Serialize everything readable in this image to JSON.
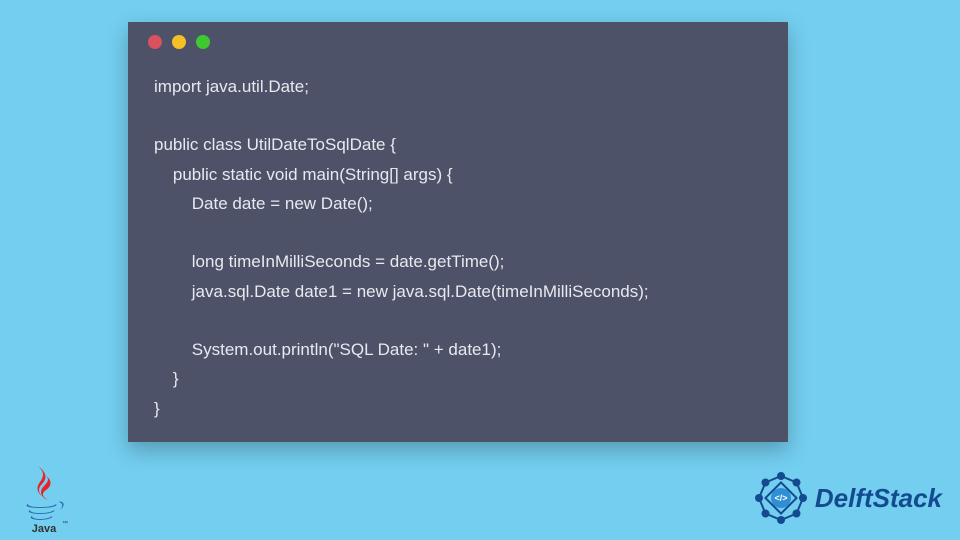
{
  "code": {
    "lines": [
      "import java.util.Date;",
      "",
      "public class UtilDateToSqlDate {",
      "    public static void main(String[] args) {",
      "        Date date = new Date();",
      "",
      "        long timeInMilliSeconds = date.getTime();",
      "        java.sql.Date date1 = new java.sql.Date(timeInMilliSeconds);",
      "",
      "        System.out.println(\"SQL Date: \" + date1);",
      "    }",
      "}"
    ]
  },
  "brand": {
    "name": "DelftStack"
  },
  "logos": {
    "bottom_left": "java-logo",
    "bottom_right": "delftstack-logo"
  },
  "window": {
    "controls": [
      "close",
      "minimize",
      "zoom"
    ]
  }
}
